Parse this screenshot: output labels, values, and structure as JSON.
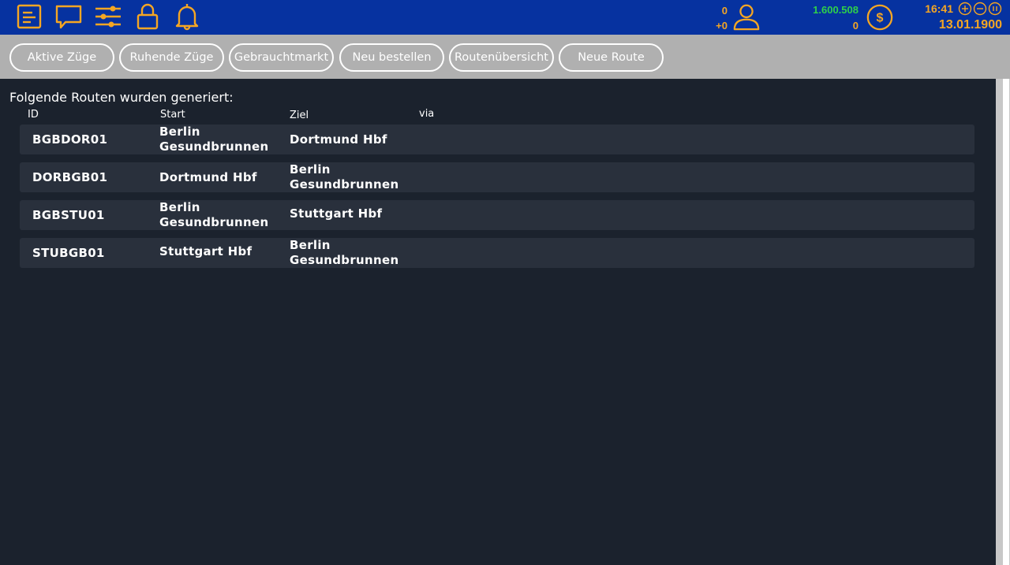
{
  "topbar": {
    "icons": [
      "notes-icon",
      "chat-icon",
      "sliders-icon",
      "lock-icon",
      "bell-icon"
    ],
    "passengers": {
      "value": "0",
      "delta": "+0"
    },
    "money": {
      "balance": "1.600.508",
      "delta": "0"
    },
    "time": "16:41",
    "date": "13.01.1900",
    "colors": {
      "bar": "#0632a0",
      "accent": "#f5a623",
      "money": "#2fd04a"
    }
  },
  "nav": {
    "buttons": [
      "Aktive Züge",
      "Ruhende Züge",
      "Gebrauchtmarkt",
      "Neu bestellen",
      "Routenübersicht",
      "Neue Route"
    ]
  },
  "routes": {
    "intro": "Folgende Routen wurden generiert:",
    "columns": [
      "ID",
      "Start",
      "Ziel",
      "via"
    ],
    "rows": [
      {
        "id": "BGBDOR01",
        "start": [
          "Berlin",
          "Gesundbrunnen"
        ],
        "ziel": [
          "Dortmund Hbf"
        ],
        "via": ""
      },
      {
        "id": "DORBGB01",
        "start": [
          "Dortmund Hbf"
        ],
        "ziel": [
          "Berlin",
          "Gesundbrunnen"
        ],
        "via": ""
      },
      {
        "id": "BGBSTU01",
        "start": [
          "Berlin",
          "Gesundbrunnen"
        ],
        "ziel": [
          "Stuttgart Hbf"
        ],
        "via": ""
      },
      {
        "id": "STUBGB01",
        "start": [
          "Stuttgart Hbf"
        ],
        "ziel": [
          "Berlin",
          "Gesundbrunnen"
        ],
        "via": ""
      }
    ]
  }
}
